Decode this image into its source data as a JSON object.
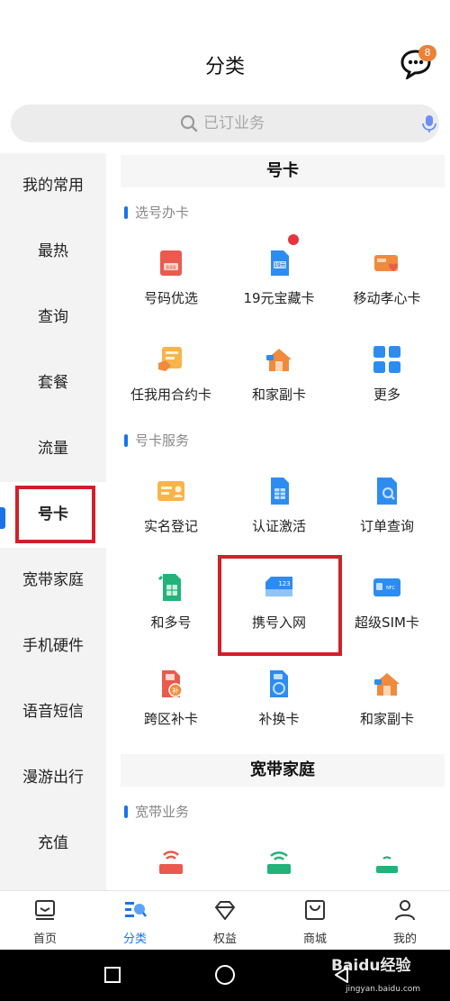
{
  "header": {
    "title": "分类",
    "message_badge": "8"
  },
  "search": {
    "placeholder": "已订业务"
  },
  "sidebar": {
    "items": [
      {
        "label": "我的常用"
      },
      {
        "label": "最热"
      },
      {
        "label": "查询"
      },
      {
        "label": "套餐"
      },
      {
        "label": "流量"
      },
      {
        "label": "号卡"
      },
      {
        "label": "宽带家庭"
      },
      {
        "label": "手机硬件"
      },
      {
        "label": "语音短信"
      },
      {
        "label": "漫游出行"
      },
      {
        "label": "充值"
      }
    ],
    "active_index": 5
  },
  "main": {
    "sections": [
      {
        "title": "号卡",
        "groups": [
          {
            "title": "选号办卡",
            "items": [
              {
                "label": "号码优选",
                "icon": "card-number-icon"
              },
              {
                "label": "19元宝藏卡",
                "icon": "sim-19-icon",
                "badge_dot": true
              },
              {
                "label": "移动孝心卡",
                "icon": "heart-card-icon"
              },
              {
                "label": "任我用合约卡",
                "icon": "contract-card-icon"
              },
              {
                "label": "和家副卡",
                "icon": "family-house-icon"
              },
              {
                "label": "更多",
                "icon": "more-grid-icon"
              }
            ]
          },
          {
            "title": "号卡服务",
            "items": [
              {
                "label": "实名登记",
                "icon": "id-card-icon"
              },
              {
                "label": "认证激活",
                "icon": "sim-activate-icon"
              },
              {
                "label": "订单查询",
                "icon": "order-search-icon"
              },
              {
                "label": "和多号",
                "icon": "multi-number-icon"
              },
              {
                "label": "携号入网",
                "icon": "port-in-card-icon",
                "card_text": "123"
              },
              {
                "label": "超级SIM卡",
                "icon": "nfc-sim-icon",
                "card_text": "NFC"
              },
              {
                "label": "跨区补卡",
                "icon": "sim-replace-icon",
                "card_text": "补"
              },
              {
                "label": "补换卡",
                "icon": "sim-swap-icon"
              },
              {
                "label": "和家副卡",
                "icon": "family-house-icon"
              }
            ]
          }
        ]
      },
      {
        "title": "宽带家庭",
        "groups": [
          {
            "title": "宽带业务",
            "items": [
              {
                "label": "",
                "icon": "router-icon"
              },
              {
                "label": "",
                "icon": "wifi-router-icon"
              },
              {
                "label": "",
                "icon": "router-small-icon"
              }
            ]
          }
        ]
      }
    ]
  },
  "tabbar": {
    "items": [
      {
        "label": "首页",
        "icon": "home-icon"
      },
      {
        "label": "分类",
        "icon": "category-icon"
      },
      {
        "label": "权益",
        "icon": "diamond-icon"
      },
      {
        "label": "商城",
        "icon": "shop-bag-icon"
      },
      {
        "label": "我的",
        "icon": "user-icon"
      }
    ],
    "active_index": 1
  },
  "watermark": {
    "text": "Baidu经验",
    "sub": "jingyan.baidu.com"
  },
  "colors": {
    "accent": "#1a73e8",
    "highlight_box": "#d0202a",
    "badge": "#e8823a",
    "icon_orange": "#f08a3c",
    "icon_red": "#ea5a4e",
    "icon_green": "#23b27a"
  }
}
